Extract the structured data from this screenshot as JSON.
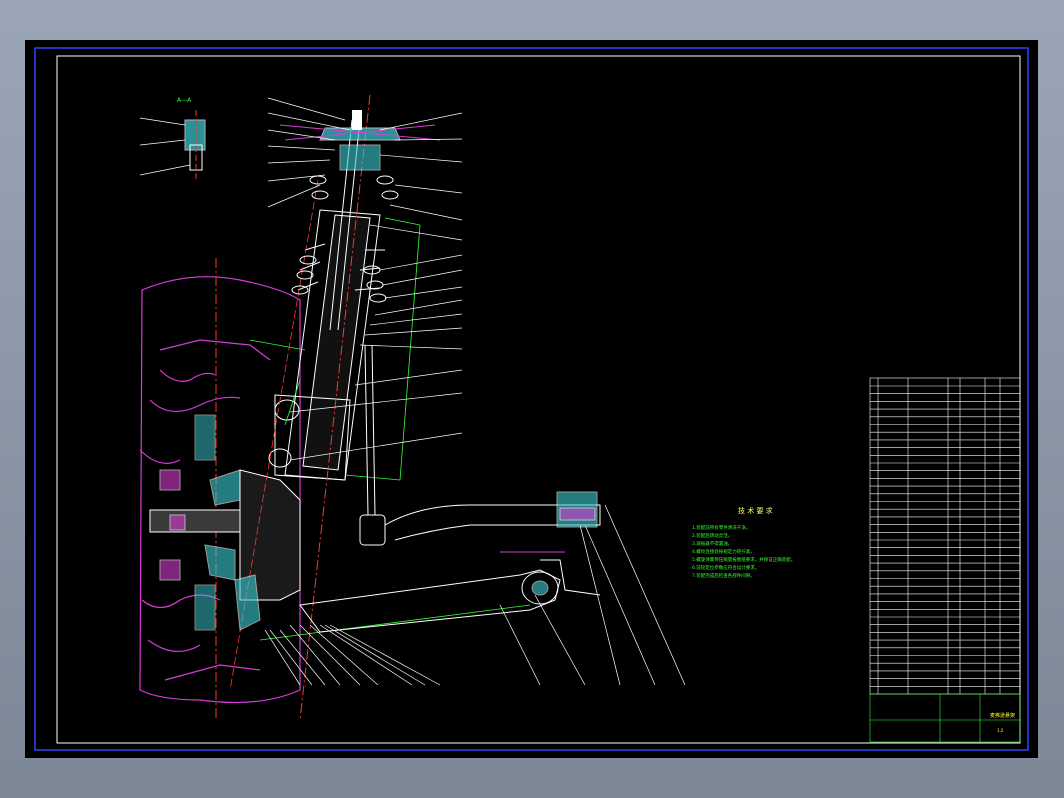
{
  "drawing": {
    "section_label": "A—A",
    "requirements_title": "技 术 要 求",
    "requirements": [
      "1.装配前所有零件清洗干净。",
      "2.装配后转动灵活。",
      "3.减振器不得漏油。",
      "4.螺纹连接处按规定力矩拧紧。",
      "5.螺旋弹簧预压缩量按图纸要求，并保证正确装配。",
      "6.前轮定位参数应符合设计要求。",
      "7.装配完成后检查各部件间隙。"
    ],
    "title_block_name": "麦弗逊悬架",
    "title_block_scale": "1:2"
  },
  "colors": {
    "background": "#000000",
    "outline": "#ffffff",
    "tire": "#d63cd6",
    "hatch": "#3ccfd6",
    "dimension": "#33ff33",
    "centerline": "#ff3333",
    "title": "#ffff66"
  }
}
